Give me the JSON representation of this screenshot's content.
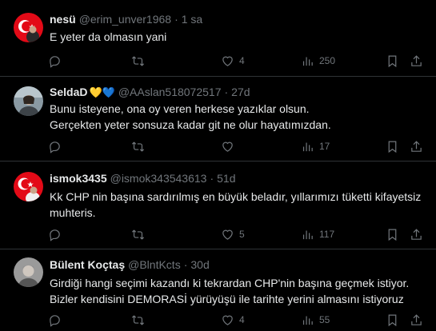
{
  "tweets": [
    {
      "name": "nesü",
      "handle": "@erim_unver1968",
      "separator": "·",
      "time": "1 sa",
      "lines": [
        "E yeter da  olmasın yani"
      ],
      "replies": "",
      "retweets": "",
      "likes": "4",
      "views": "250",
      "avatar": "turkish-flag-portrait"
    },
    {
      "name": "SeldaD",
      "hearts": [
        "💛",
        "💙"
      ],
      "handle": "@AAslan518072517",
      "separator": "·",
      "time": "27d",
      "lines": [
        "Bunu isteyene, ona oy veren herkese yazıklar olsun.",
        "Gerçekten yeter sonsuza kadar git ne olur hayatımızdan."
      ],
      "replies": "",
      "retweets": "",
      "likes": "",
      "views": "17",
      "avatar": "photo-portrait"
    },
    {
      "name": "ismok3435",
      "handle": "@ismok343543613",
      "separator": "·",
      "time": "51d",
      "lines": [
        "Kk CHP nin başına sardırılmış en büyük beladır, yıllarımızı tüketti kifayetsiz",
        "muhteris."
      ],
      "replies": "",
      "retweets": "",
      "likes": "5",
      "views": "117",
      "avatar": "turkish-flag-portrait"
    },
    {
      "name": "Bülent Koçtaş",
      "handle": "@BlntKcts",
      "separator": "·",
      "time": "30d",
      "lines": [
        "Girdiği hangi seçimi kazandı ki tekrardan CHP'nin başına geçmek istiyor.",
        "Bizler kendisini DEMORASİ yürüyüşü ile tarihte yerini almasını istiyoruz"
      ],
      "replies": "",
      "retweets": "",
      "likes": "4",
      "views": "55",
      "avatar": "grey-portrait"
    }
  ],
  "colors": {
    "background": "#000000",
    "text": "#e7e9ea",
    "muted": "#71767b",
    "divider": "#2f3336",
    "flag_red": "#e30a17"
  },
  "icons": [
    "reply-icon",
    "retweet-icon",
    "like-icon",
    "views-icon",
    "bookmark-icon",
    "share-icon"
  ]
}
